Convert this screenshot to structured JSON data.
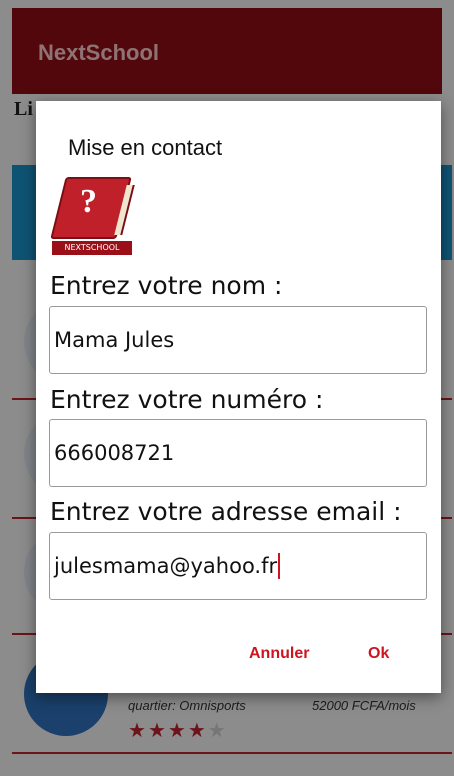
{
  "app": {
    "title": "NextSchool",
    "background": {
      "heading": "Li                                                              u",
      "list_item": {
        "location": "quartier: Omnisports",
        "price": "52000 FCFA/mois",
        "rating_stars": 4,
        "rating_max": 5
      }
    }
  },
  "dialog": {
    "title": "Mise en contact",
    "logo_text": "NEXTSCHOOL",
    "name_label": "Entrez votre nom :",
    "name_value": "Mama Jules",
    "phone_label": "Entrez votre numéro :",
    "phone_value": "666008721",
    "email_label": "Entrez votre adresse email :",
    "email_value": "julesmama@yahoo.fr",
    "cancel_label": "Annuler",
    "ok_label": "Ok"
  },
  "colors": {
    "brand": "#8e0d16",
    "accent": "#d0141f",
    "info_blue": "#1a8fc9"
  }
}
